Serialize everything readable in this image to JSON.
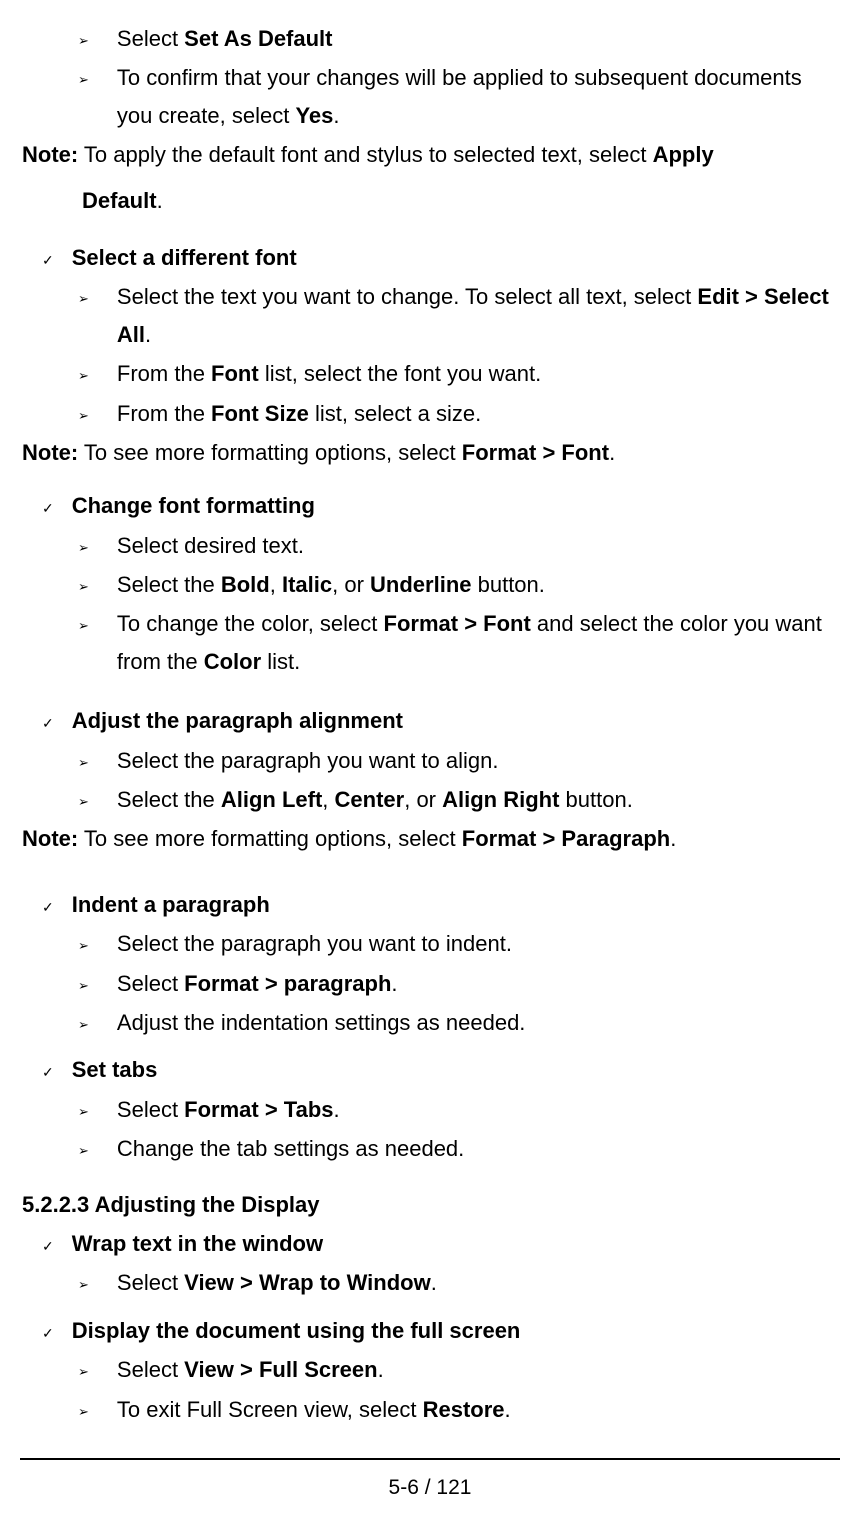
{
  "items": {
    "l1": "Select <b>Set As Default</b>",
    "l2": "To confirm that your changes will be applied to subsequent documents you create, select <b>Yes</b>.",
    "note1": "<b>Note:</b> To apply the default font and stylus to selected text, select <b>Apply</b>",
    "note1b": "<b>Default</b>.",
    "h1": "<b>Select a different font</b>",
    "l3": "Select the text you want to change. To select all text, select <b>Edit > Select All</b>.",
    "l4": "From the <b>Font</b> list, select the font you want.",
    "l5": "From the <b>Font Size</b> list, select a size.",
    "note2": "<b>Note:</b> To see more formatting options, select <b>Format > Font</b>.",
    "h2": "<b>Change font formatting</b>",
    "l6": "Select desired text.",
    "l7": "Select the <b>Bold</b>, <b>Italic</b>, or <b>Underline</b> button.",
    "l8": "To change the color, select <b>Format > Font</b> and select the color you want from the <b>Color</b> list.",
    "h3": "<b>Adjust the paragraph alignment</b>",
    "l9": "Select the paragraph you want to align.",
    "l10": "Select the <b>Align Left</b>, <b>Center</b>, or <b>Align Right</b> button.",
    "note3": "<b>Note:</b> To see more formatting options, select <b>Format > Paragraph</b>.",
    "h4": "<b>Indent a paragraph</b>",
    "l11": "Select the paragraph you want to indent.",
    "l12": "Select <b>Format > paragraph</b>.",
    "l13": "Adjust the indentation settings as needed.",
    "h5": "<b>Set tabs</b>",
    "l14": "Select <b>Format > Tabs</b>.",
    "l15": "Change the tab settings as needed.",
    "sec": "5.2.2.3 Adjusting the Display",
    "h6": "<b>Wrap text in the window</b>",
    "l16": "Select <b>View > Wrap to Window</b>.",
    "h7": "<b>Display the document using the full screen</b>",
    "l17": "Select <b>View > Full Screen</b>.",
    "l18": "To exit Full Screen view, select <b>Restore</b>."
  },
  "footer": "5-6 / 121"
}
